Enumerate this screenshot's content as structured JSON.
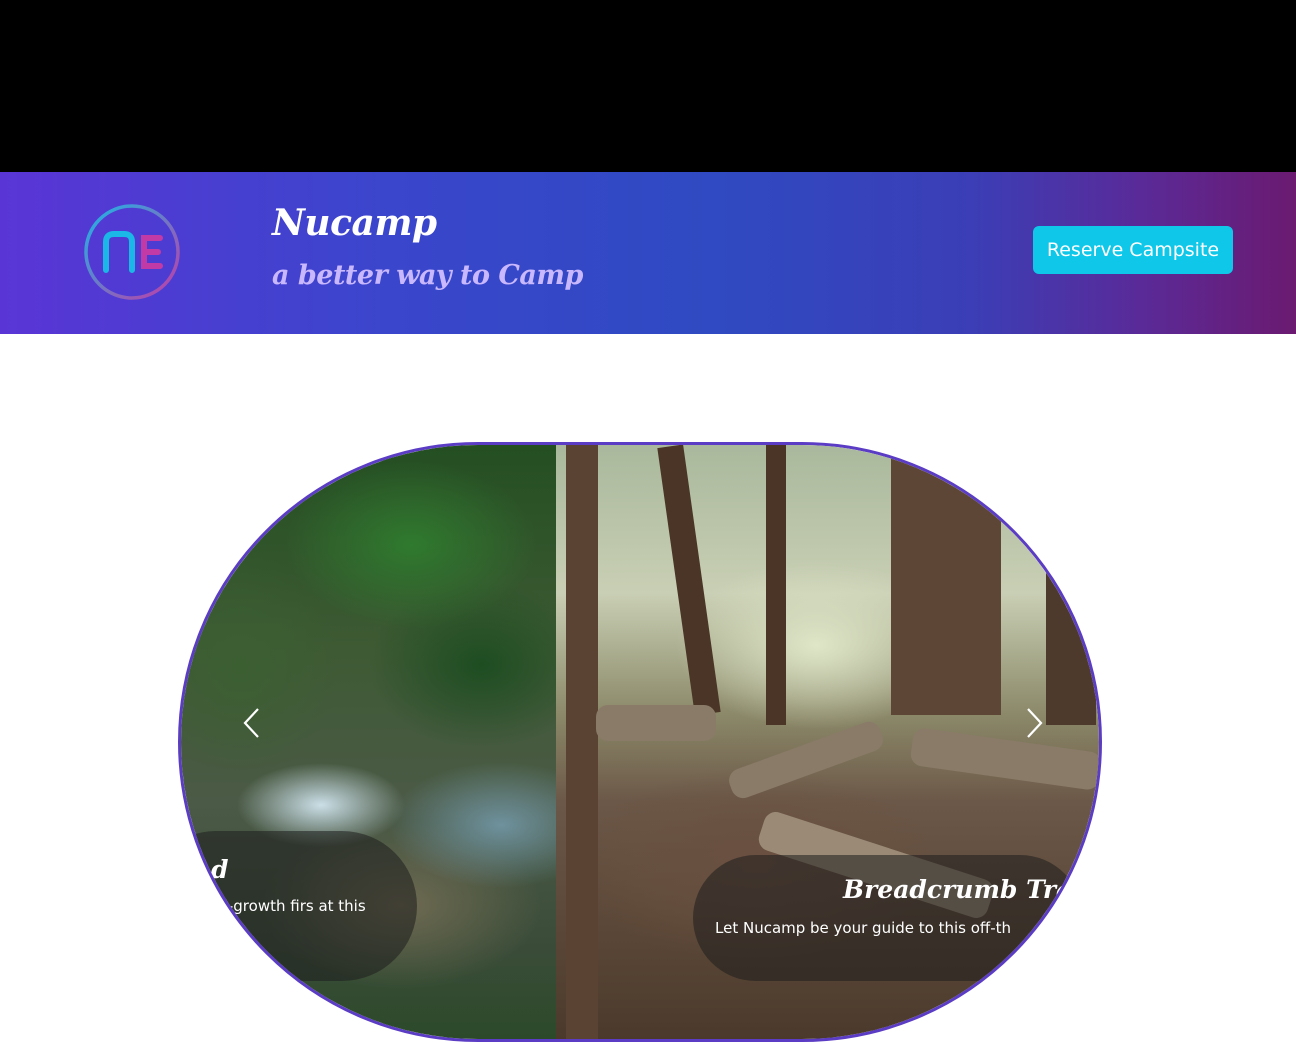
{
  "header": {
    "brand": "Nucamp",
    "tagline": "a better way to Camp",
    "reserve_label": "Reserve Campsite"
  },
  "carousel": {
    "slides": [
      {
        "title": "d",
        "text": "old-growth firs at this"
      },
      {
        "title": "Breadcrumb Trail",
        "text": "Let Nucamp be your guide to this off-th"
      }
    ],
    "prev_icon": "chevron-left-icon",
    "next_icon": "chevron-right-icon"
  },
  "colors": {
    "accent": "#0fc7e8",
    "border": "#5b3cc4"
  }
}
